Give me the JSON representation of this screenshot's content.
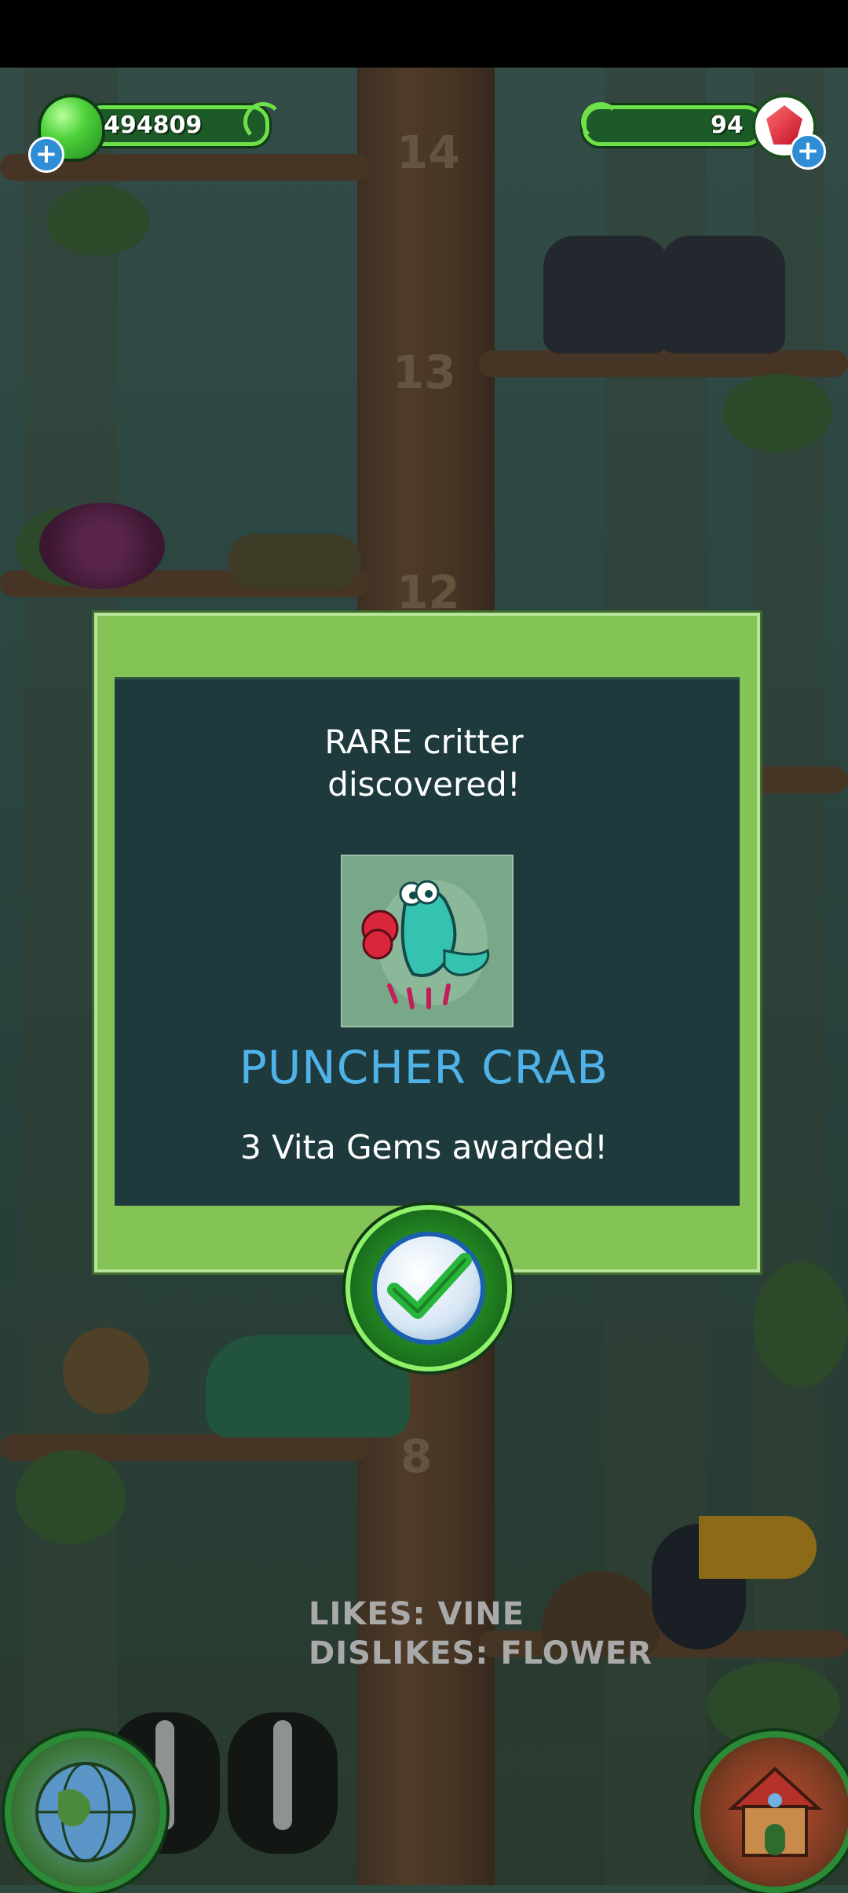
{
  "hud": {
    "goo_count": "494809",
    "gem_count": "94",
    "add_goo_label": "+",
    "add_gems_label": "+"
  },
  "tree": {
    "levels": [
      "14",
      "13",
      "12",
      "8"
    ]
  },
  "preferences": {
    "likes": "LIKES: VINE",
    "dislikes": "DISLIKES: FLOWER"
  },
  "dialog": {
    "title_line1": "RARE critter",
    "title_line2": "discovered!",
    "critter_name": "PUNCHER CRAB",
    "reward_text": "3 Vita Gems awarded!",
    "confirm_icon": "checkmark-icon"
  },
  "colors": {
    "panel_green": "#84c356",
    "panel_dark": "#1e3a3c",
    "critter_name_blue": "#4fb2e8",
    "hud_green": "#6ee04a"
  },
  "icons": {
    "goo": "green-goo-icon",
    "gems": "red-gem-icon",
    "world": "globe-icon",
    "home": "house-icon"
  }
}
